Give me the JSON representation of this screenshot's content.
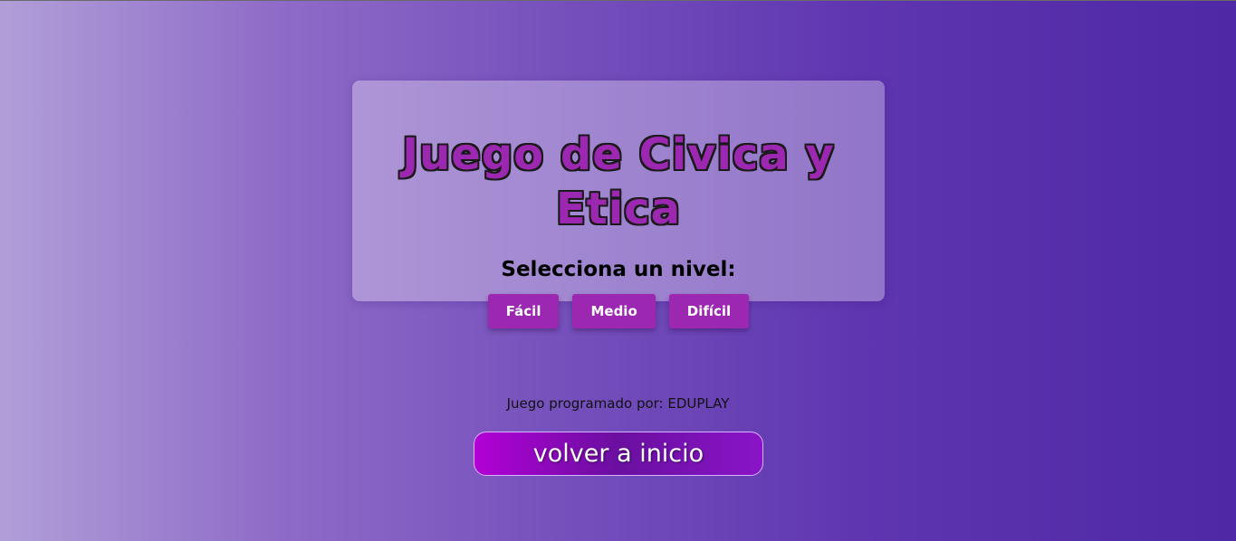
{
  "game": {
    "title": "Juego de Civica y Etica",
    "select_prompt": "Selecciona un nivel:",
    "levels": [
      {
        "label": "Fácil"
      },
      {
        "label": "Medio"
      },
      {
        "label": "Difícil"
      }
    ]
  },
  "footer": {
    "credit": "Juego programado por: EDUPLAY",
    "back_label": "volver a inicio"
  },
  "colors": {
    "accent": "#9c27b0",
    "background_start": "#b19fd8",
    "background_end": "#4e28a6"
  }
}
